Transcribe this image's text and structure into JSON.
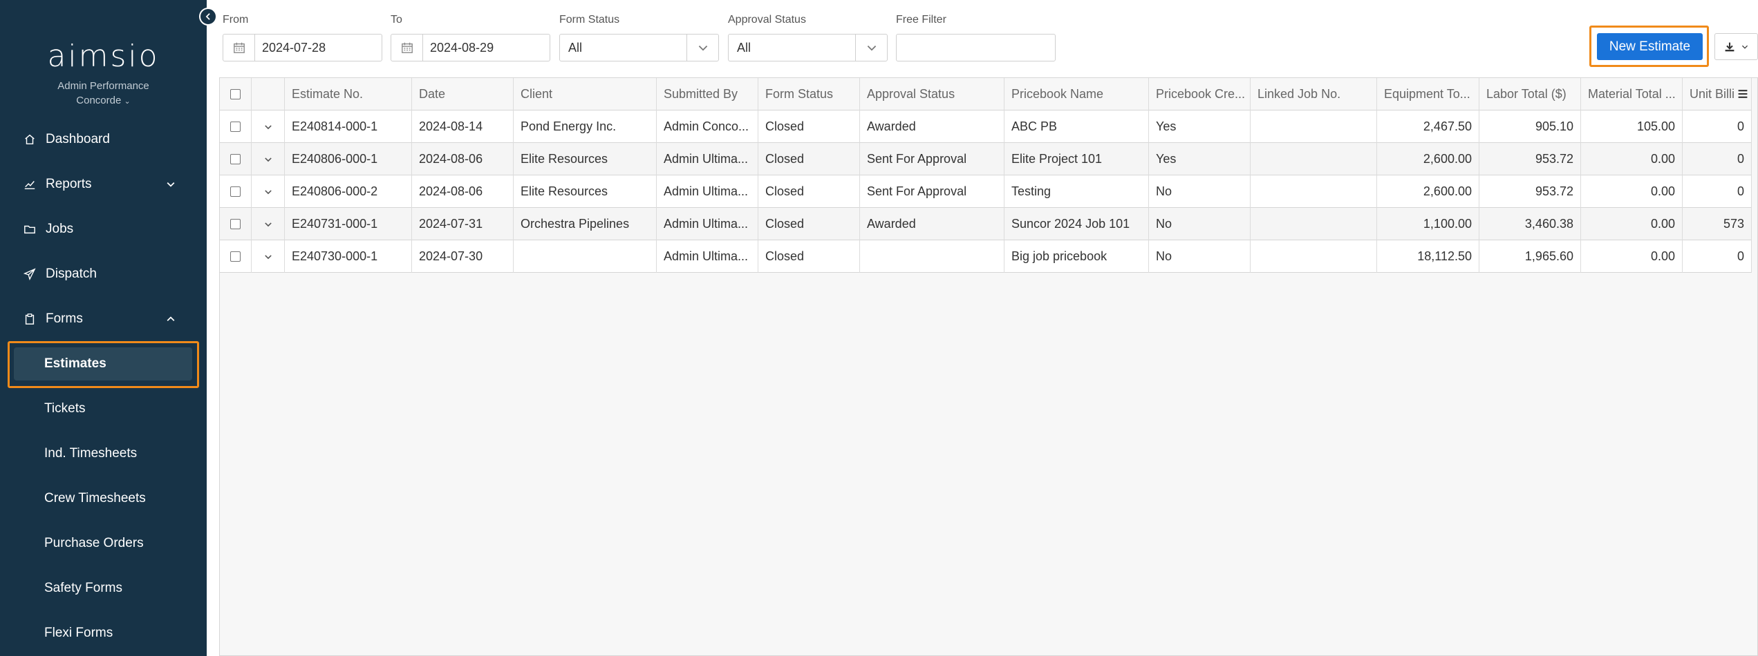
{
  "sidebar": {
    "logo": "aimsio",
    "company_line1": "Admin Performance",
    "company_line2": "Concorde",
    "nav": [
      {
        "label": "Dashboard",
        "icon": "home-icon"
      },
      {
        "label": "Reports",
        "icon": "chart-icon",
        "arrow": "chevron-down-icon"
      },
      {
        "label": "Jobs",
        "icon": "folder-icon"
      },
      {
        "label": "Dispatch",
        "icon": "paper-plane-icon"
      },
      {
        "label": "Forms",
        "icon": "clipboard-icon",
        "arrow": "chevron-up-icon"
      }
    ],
    "forms_items": [
      {
        "label": "Estimates",
        "active": true
      },
      {
        "label": "Tickets"
      },
      {
        "label": "Ind. Timesheets"
      },
      {
        "label": "Crew Timesheets"
      },
      {
        "label": "Purchase Orders"
      },
      {
        "label": "Safety Forms"
      },
      {
        "label": "Flexi Forms"
      }
    ]
  },
  "filters": {
    "from_label": "From",
    "from_value": "2024-07-28",
    "to_label": "To",
    "to_value": "2024-08-29",
    "form_status_label": "Form Status",
    "form_status_value": "All",
    "approval_status_label": "Approval Status",
    "approval_status_value": "All",
    "free_filter_label": "Free Filter",
    "free_filter_value": ""
  },
  "toolbar": {
    "new_estimate": "New Estimate",
    "export_icon": "download-icon"
  },
  "table": {
    "columns": [
      "Estimate No.",
      "Date",
      "Client",
      "Submitted By",
      "Form Status",
      "Approval Status",
      "Pricebook Name",
      "Pricebook Cre...",
      "Linked Job No.",
      "Equipment To...",
      "Labor Total ($)",
      "Material Total ...",
      "Unit Billin"
    ],
    "rows": [
      [
        "E240814-000-1",
        "2024-08-14",
        "Pond Energy Inc.",
        "Admin Conco...",
        "Closed",
        "Awarded",
        "ABC PB",
        "Yes",
        "",
        "2,467.50",
        "905.10",
        "105.00",
        "0"
      ],
      [
        "E240806-000-1",
        "2024-08-06",
        "Elite Resources",
        "Admin Ultima...",
        "Closed",
        "Sent For Approval",
        "Elite Project 101",
        "Yes",
        "",
        "2,600.00",
        "953.72",
        "0.00",
        "0"
      ],
      [
        "E240806-000-2",
        "2024-08-06",
        "Elite Resources",
        "Admin Ultima...",
        "Closed",
        "Sent For Approval",
        "Testing",
        "No",
        "",
        "2,600.00",
        "953.72",
        "0.00",
        "0"
      ],
      [
        "E240731-000-1",
        "2024-07-31",
        "Orchestra Pipelines",
        "Admin Ultima...",
        "Closed",
        "Awarded",
        "Suncor 2024 Job 101",
        "No",
        "",
        "1,100.00",
        "3,460.38",
        "0.00",
        "573"
      ],
      [
        "E240730-000-1",
        "2024-07-30",
        "",
        "Admin Ultima...",
        "Closed",
        "",
        "Big job pricebook",
        "No",
        "",
        "18,112.50",
        "1,965.60",
        "0.00",
        "0"
      ]
    ]
  },
  "colors": {
    "sidebar_bg": "#173347",
    "accent": "#1a73d9",
    "highlight": "#f08a19"
  }
}
